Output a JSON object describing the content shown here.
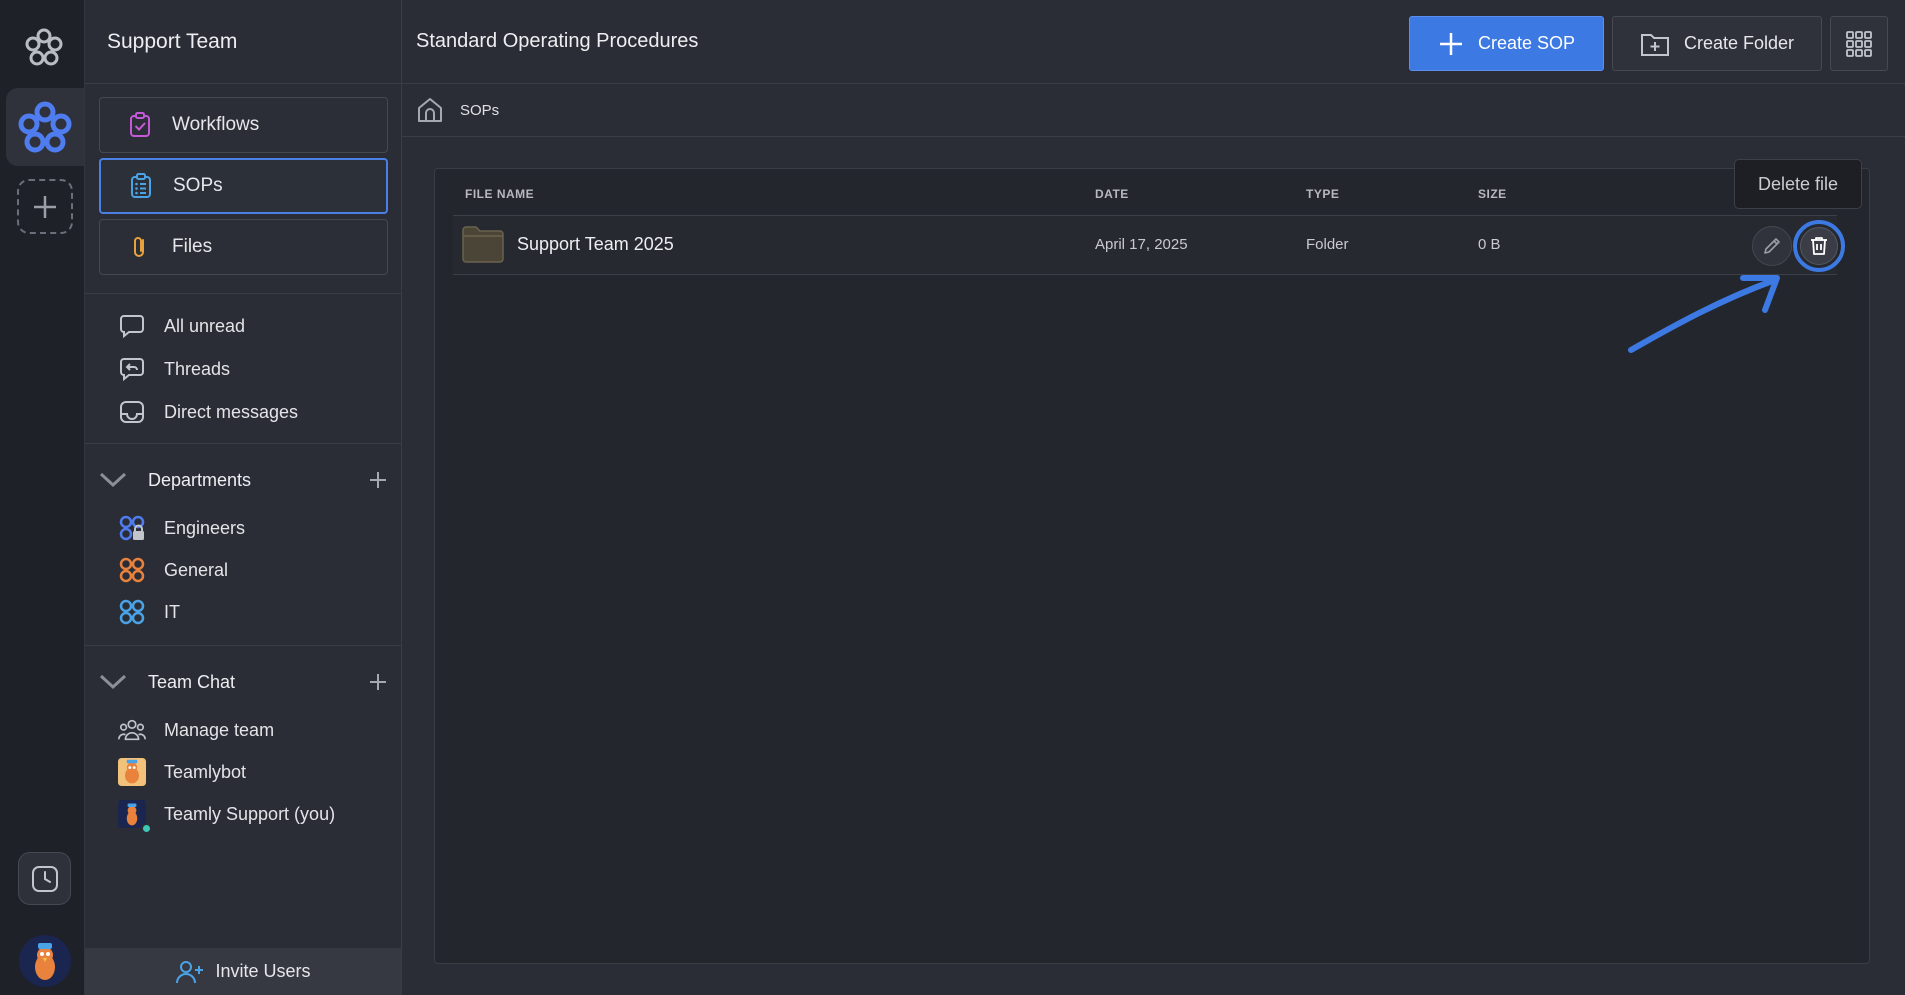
{
  "workspace": {
    "name": "Support Team"
  },
  "sidebar": {
    "nav": [
      {
        "label": "Workflows",
        "icon": "clipboard-check-icon",
        "active": false
      },
      {
        "label": "SOPs",
        "icon": "list-document-icon",
        "active": true
      },
      {
        "label": "Files",
        "icon": "paperclip-icon",
        "active": false
      }
    ],
    "quick": [
      {
        "label": "All unread",
        "icon": "chat-bubble-icon"
      },
      {
        "label": "Threads",
        "icon": "thread-icon"
      },
      {
        "label": "Direct messages",
        "icon": "inbox-icon"
      }
    ],
    "departments": {
      "title": "Departments",
      "items": [
        {
          "label": "Engineers",
          "icon": "locked-group-icon",
          "color": "#4f7df0"
        },
        {
          "label": "General",
          "icon": "group-icon",
          "color": "#e8823d"
        },
        {
          "label": "IT",
          "icon": "group-icon",
          "color": "#4aa3e6"
        }
      ]
    },
    "team_chat": {
      "title": "Team Chat",
      "items": [
        {
          "label": "Manage team",
          "icon": "team-icon"
        },
        {
          "label": "Teamlybot",
          "icon": "bot-avatar"
        },
        {
          "label": "Teamly Support (you)",
          "icon": "user-avatar"
        }
      ]
    },
    "invite_label": "Invite Users"
  },
  "main": {
    "title": "Standard Operating Procedures",
    "create_sop_label": "Create SOP",
    "create_folder_label": "Create Folder",
    "breadcrumb": "SOPs",
    "table": {
      "columns": [
        "FILE NAME",
        "DATE",
        "TYPE",
        "SIZE"
      ],
      "rows": [
        {
          "name": "Support Team 2025",
          "date": "April 17, 2025",
          "type": "Folder",
          "size": "0 B"
        }
      ]
    },
    "tooltip": "Delete file"
  },
  "colors": {
    "accent": "#3c79e3",
    "folder": "#4a4537"
  }
}
